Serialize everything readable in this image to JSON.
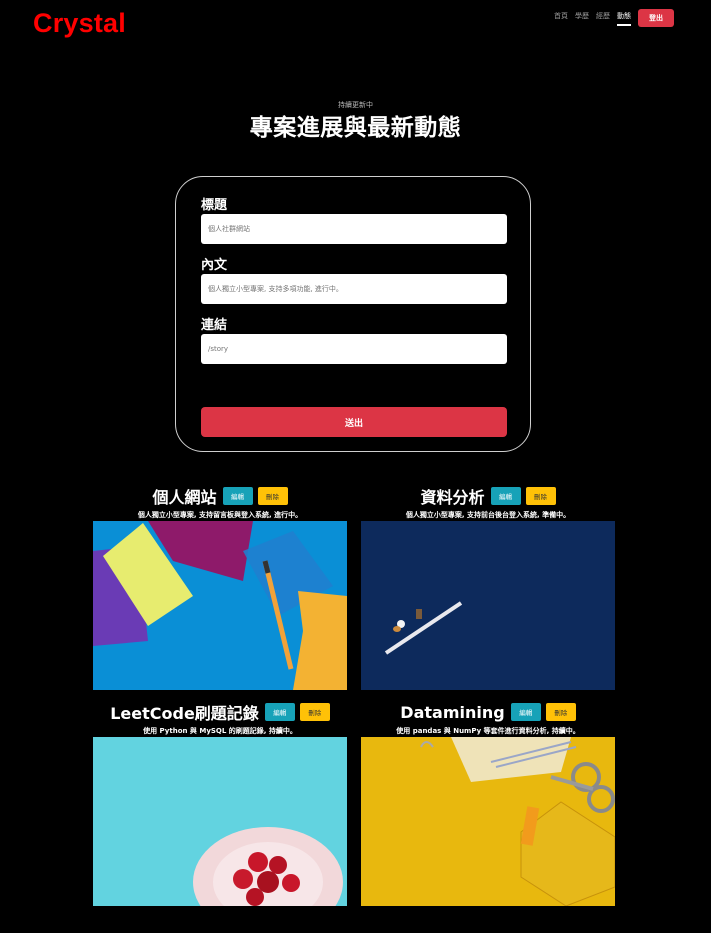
{
  "brand": "Crystal",
  "nav": {
    "links": [
      {
        "label": "首頁",
        "active": false
      },
      {
        "label": "學歷",
        "active": false
      },
      {
        "label": "經歷",
        "active": false
      },
      {
        "label": "動態",
        "active": true
      }
    ],
    "logout_label": "登出"
  },
  "hero": {
    "eyebrow": "持續更新中",
    "title": "專案進展與最新動態"
  },
  "form": {
    "title_label": "標題",
    "title_placeholder": "個人社群網站",
    "content_label": "內文",
    "content_placeholder": "個人獨立小型專案, 支持多項功能, 進行中。",
    "link_label": "連結",
    "link_placeholder": "/story",
    "submit_label": "送出"
  },
  "projects": [
    {
      "title": "個人網站",
      "edit_label": "編輯",
      "delete_label": "刪除",
      "description": "個人獨立小型專案, 支持留言板與登入系統, 進行中。"
    },
    {
      "title": "資料分析",
      "edit_label": "編輯",
      "delete_label": "刪除",
      "description": "個人獨立小型專案, 支持前台後台登入系統, 準備中。"
    },
    {
      "title": "LeetCode刷題記錄",
      "edit_label": "編輯",
      "delete_label": "刪除",
      "description": "使用 Python 與 MySQL 的刷題記錄, 持續中。"
    },
    {
      "title": "Datamining",
      "edit_label": "編輯",
      "delete_label": "刪除",
      "description": "使用 pandas 與 NumPy 等套件進行資料分析, 持續中。"
    }
  ],
  "colors": {
    "brand": "#ff0000",
    "danger": "#dc3545",
    "info": "#17a2b8",
    "warning": "#ffc107"
  }
}
